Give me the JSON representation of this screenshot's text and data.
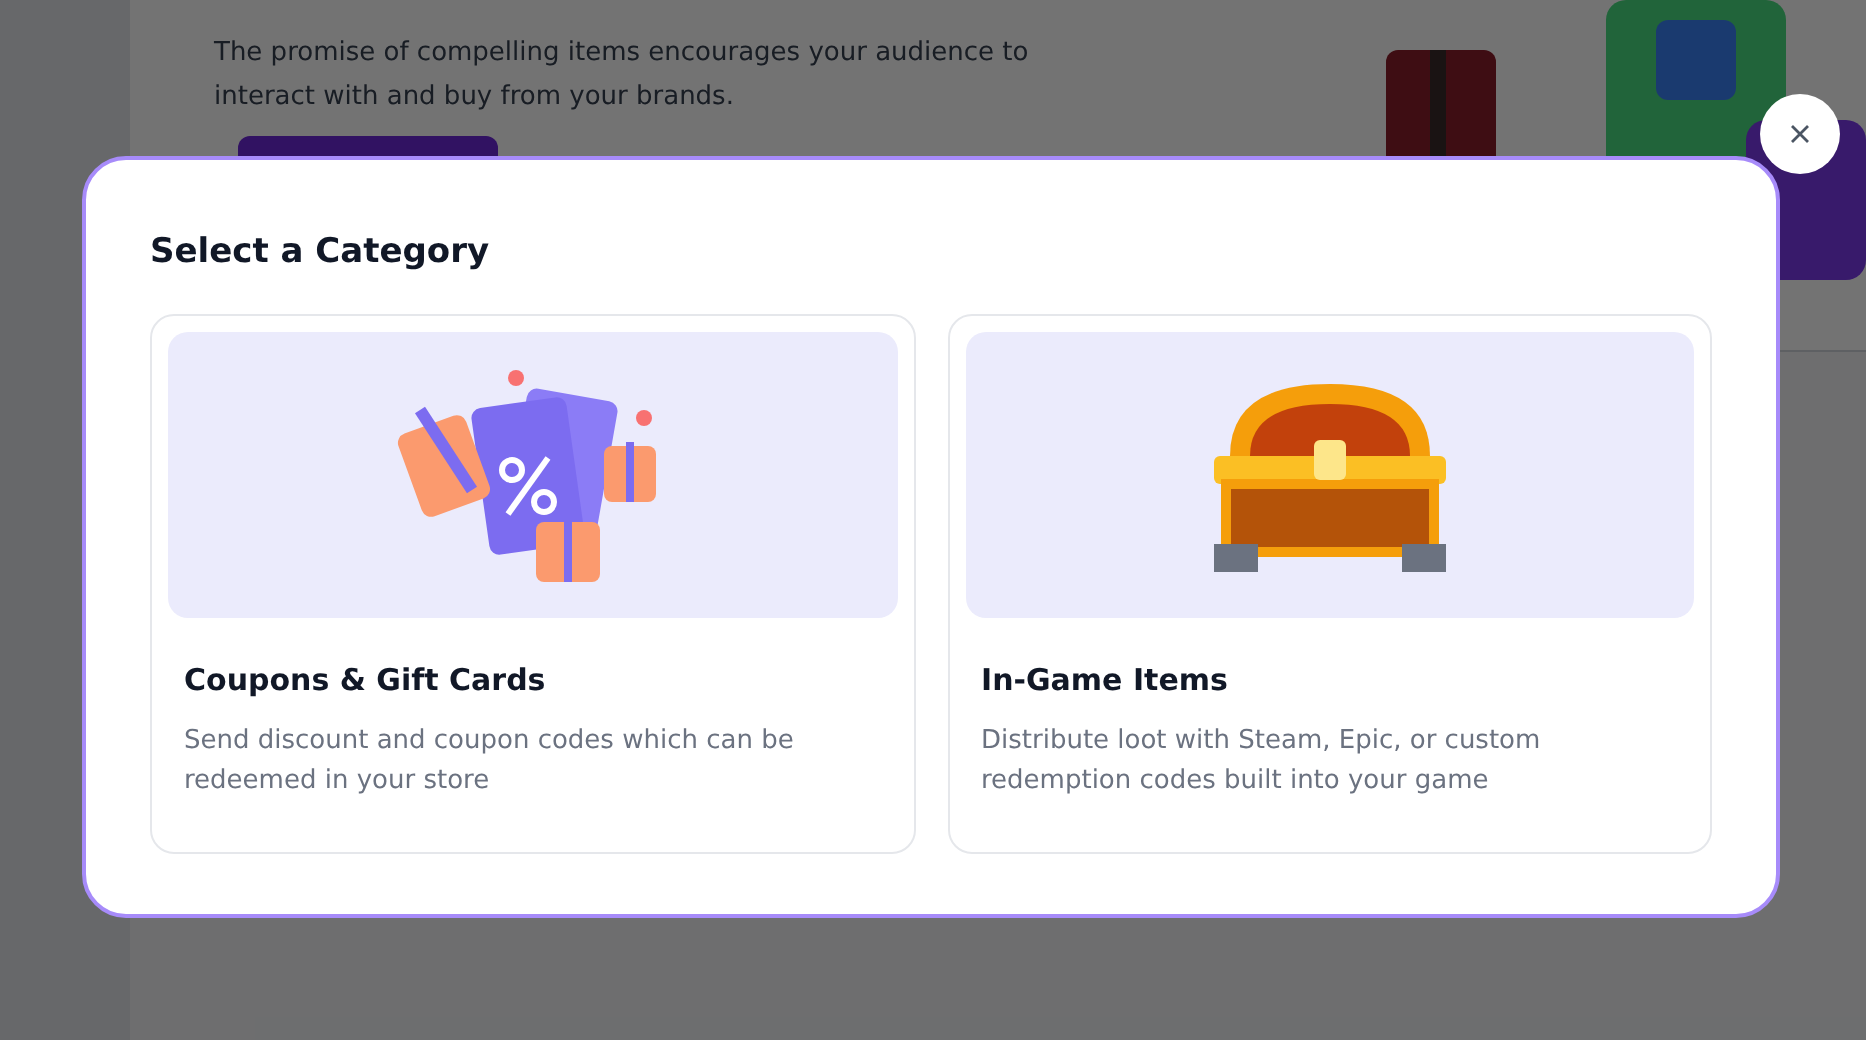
{
  "background_page": {
    "description": "The promise of compelling items encourages your audience to interact with and buy from your brands."
  },
  "modal": {
    "title": "Select a Category",
    "categories": [
      {
        "kind": "coupons",
        "title": "Coupons & Gift Cards",
        "description": "Send discount and coupon codes which can be redeemed in your store"
      },
      {
        "kind": "chest",
        "title": "In-Game Items",
        "description": "Distribute loot with Steam, Epic, or custom redemption codes built into your game"
      }
    ]
  }
}
